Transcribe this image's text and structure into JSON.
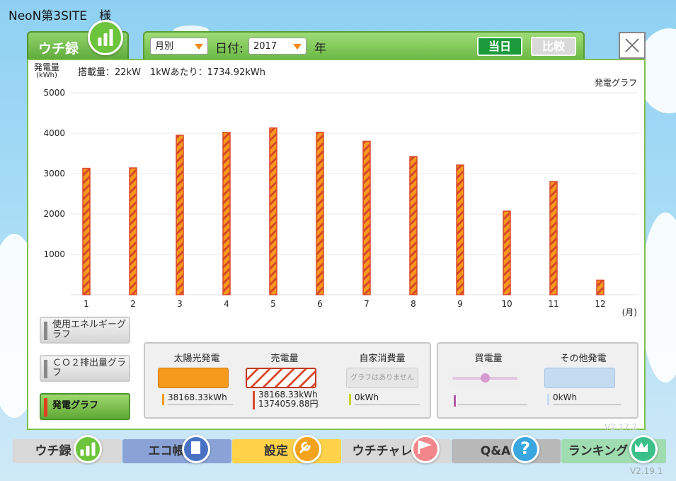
{
  "app": {
    "title": "NeoN第3SITE　様",
    "version": "V2.19.1",
    "panel_version": "V2.17.2"
  },
  "header": {
    "tab_label": "ウチ録"
  },
  "toolbar": {
    "period_select": "月別",
    "date_label": "日付:",
    "year_select": "2017",
    "year_suffix": "年",
    "today_button": "当日",
    "compare_button": "比較"
  },
  "chart_header": {
    "ylabel": "発電量",
    "yunit": "(kWh)",
    "info": "搭載量：22kW　1kWあたり：1734.92kWh",
    "graph_name": "発電グラフ"
  },
  "side_buttons": [
    {
      "label": "使用エネルギーグラフ",
      "active": false
    },
    {
      "label": "ＣＯ２排出量グラフ",
      "active": false
    },
    {
      "label": "発電グラフ",
      "active": true
    }
  ],
  "legend": {
    "solar": {
      "label": "太陽光発電",
      "value": "38168.33kWh",
      "color": "#f59a1d"
    },
    "sell": {
      "label": "売電量",
      "value": "38168.33kWh",
      "value2": "1374059.88円",
      "color": "#d8482a"
    },
    "self": {
      "label": "自家消費量",
      "swatch_text": "グラフはありません",
      "value": "0kWh",
      "color": "#c8d22a"
    },
    "buy": {
      "label": "買電量",
      "color": "#b05aa8"
    },
    "other": {
      "label": "その他発電",
      "value": "0kWh",
      "color": "#c5dbf2"
    }
  },
  "nav": [
    {
      "label": "ウチ録",
      "icon": "bar-chart-icon"
    },
    {
      "label": "エコ帳",
      "icon": "notebook-icon"
    },
    {
      "label": "設定",
      "icon": "wrench-icon"
    },
    {
      "label": "ウチチャレ",
      "icon": "flag-icon"
    },
    {
      "label": "Q&A",
      "icon": "question-icon"
    },
    {
      "label": "ランキング",
      "icon": "crown-icon"
    }
  ],
  "chart_data": {
    "type": "bar",
    "categories": [
      "1",
      "2",
      "3",
      "4",
      "5",
      "6",
      "7",
      "8",
      "9",
      "10",
      "11",
      "12"
    ],
    "values": [
      3130,
      3140,
      3950,
      4020,
      4130,
      4020,
      3800,
      3420,
      3210,
      2070,
      2800,
      360
    ],
    "ylim": [
      0,
      5000
    ],
    "yticks": [
      "5000",
      "4000",
      "3000",
      "2000",
      "1000"
    ],
    "xunit": "(月)",
    "grid": true,
    "bar_color": "#f59a1d",
    "bar_stripe_color": "#d8482a"
  }
}
